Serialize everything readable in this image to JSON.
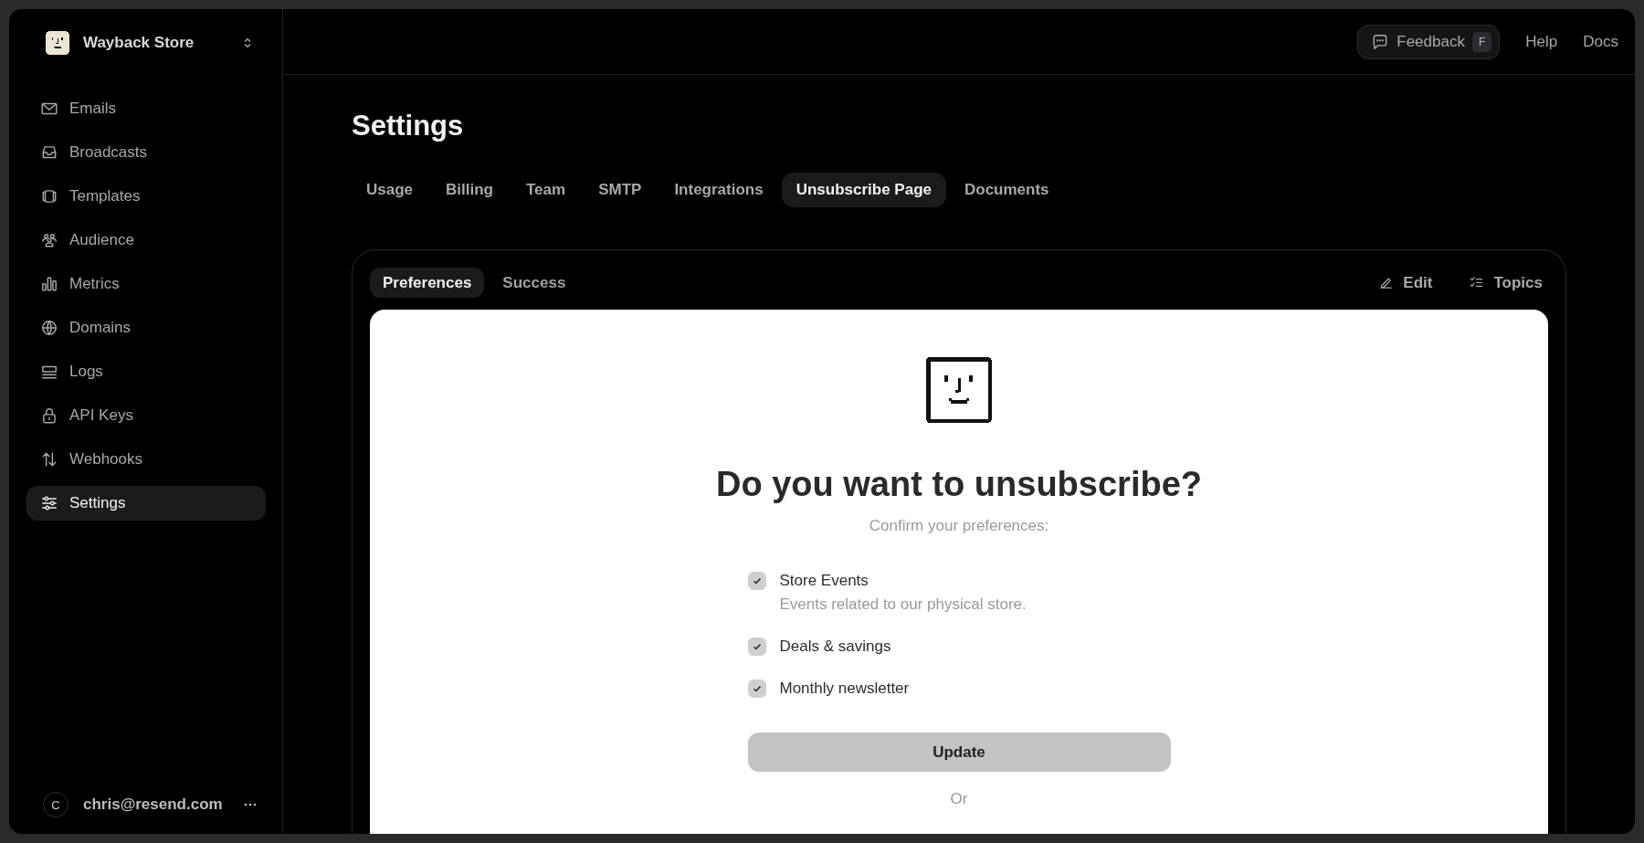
{
  "workspace": {
    "name": "Wayback Store"
  },
  "sidebar": {
    "items": [
      {
        "label": "Emails",
        "selected": false
      },
      {
        "label": "Broadcasts",
        "selected": false
      },
      {
        "label": "Templates",
        "selected": false
      },
      {
        "label": "Audience",
        "selected": false
      },
      {
        "label": "Metrics",
        "selected": false
      },
      {
        "label": "Domains",
        "selected": false
      },
      {
        "label": "Logs",
        "selected": false
      },
      {
        "label": "API Keys",
        "selected": false
      },
      {
        "label": "Webhooks",
        "selected": false
      },
      {
        "label": "Settings",
        "selected": true
      }
    ]
  },
  "user": {
    "avatar": "C",
    "email": "chris@resend.com"
  },
  "topbar": {
    "feedback": {
      "label": "Feedback",
      "shortcut": "F"
    },
    "links": [
      "Help",
      "Docs"
    ]
  },
  "page": {
    "title": "Settings"
  },
  "tabs": [
    {
      "label": "Usage",
      "selected": false
    },
    {
      "label": "Billing",
      "selected": false
    },
    {
      "label": "Team",
      "selected": false
    },
    {
      "label": "SMTP",
      "selected": false
    },
    {
      "label": "Integrations",
      "selected": false
    },
    {
      "label": "Unsubscribe Page",
      "selected": true
    },
    {
      "label": "Documents",
      "selected": false
    }
  ],
  "subtabs": [
    {
      "label": "Preferences",
      "selected": true
    },
    {
      "label": "Success",
      "selected": false
    }
  ],
  "actions": [
    "Edit",
    "Topics"
  ],
  "preview": {
    "heading": "Do you want to unsubscribe?",
    "subtitle": "Confirm your preferences:",
    "topics": [
      {
        "name": "Store Events",
        "description": "Events related to our physical store.",
        "checked": true
      },
      {
        "name": "Deals & savings",
        "checked": true
      },
      {
        "name": "Monthly newsletter",
        "checked": true
      }
    ],
    "button": "Update",
    "or": "Or"
  }
}
